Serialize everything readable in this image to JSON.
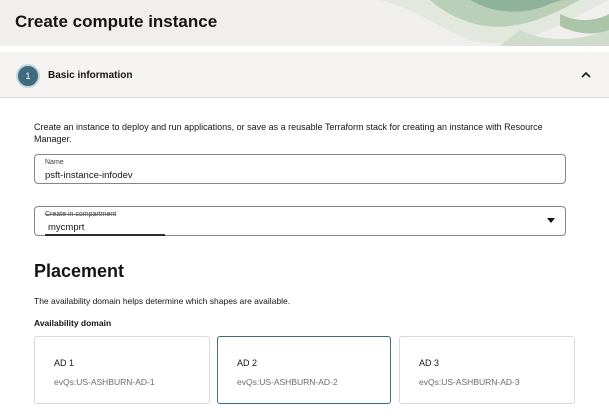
{
  "header": {
    "title": "Create compute instance"
  },
  "section": {
    "step_number": "1",
    "title": "Basic information",
    "intro": "Create an instance to deploy and run applications, or save as a reusable Terraform stack for creating an instance with Resource Manager."
  },
  "form": {
    "name": {
      "label": "Name",
      "value": "psft-instance-infodev"
    },
    "compartment": {
      "label": "Create in compartment",
      "value": "mycmprt"
    }
  },
  "placement": {
    "title": "Placement",
    "description": "The availability domain helps determine which shapes are available.",
    "ad_heading": "Availability domain",
    "domains": [
      {
        "name": "AD 1",
        "sub": "evQs:US-ASHBURN-AD-1"
      },
      {
        "name": "AD 2",
        "sub": "evQs:US-ASHBURN-AD-2"
      },
      {
        "name": "AD 3",
        "sub": "evQs:US-ASHBURN-AD-3"
      }
    ]
  },
  "colors": {
    "accent": "#3f6b7e",
    "header_bg": "#f1efed",
    "art_green": "#8fb39a",
    "art_dark": "#4e6b42"
  }
}
